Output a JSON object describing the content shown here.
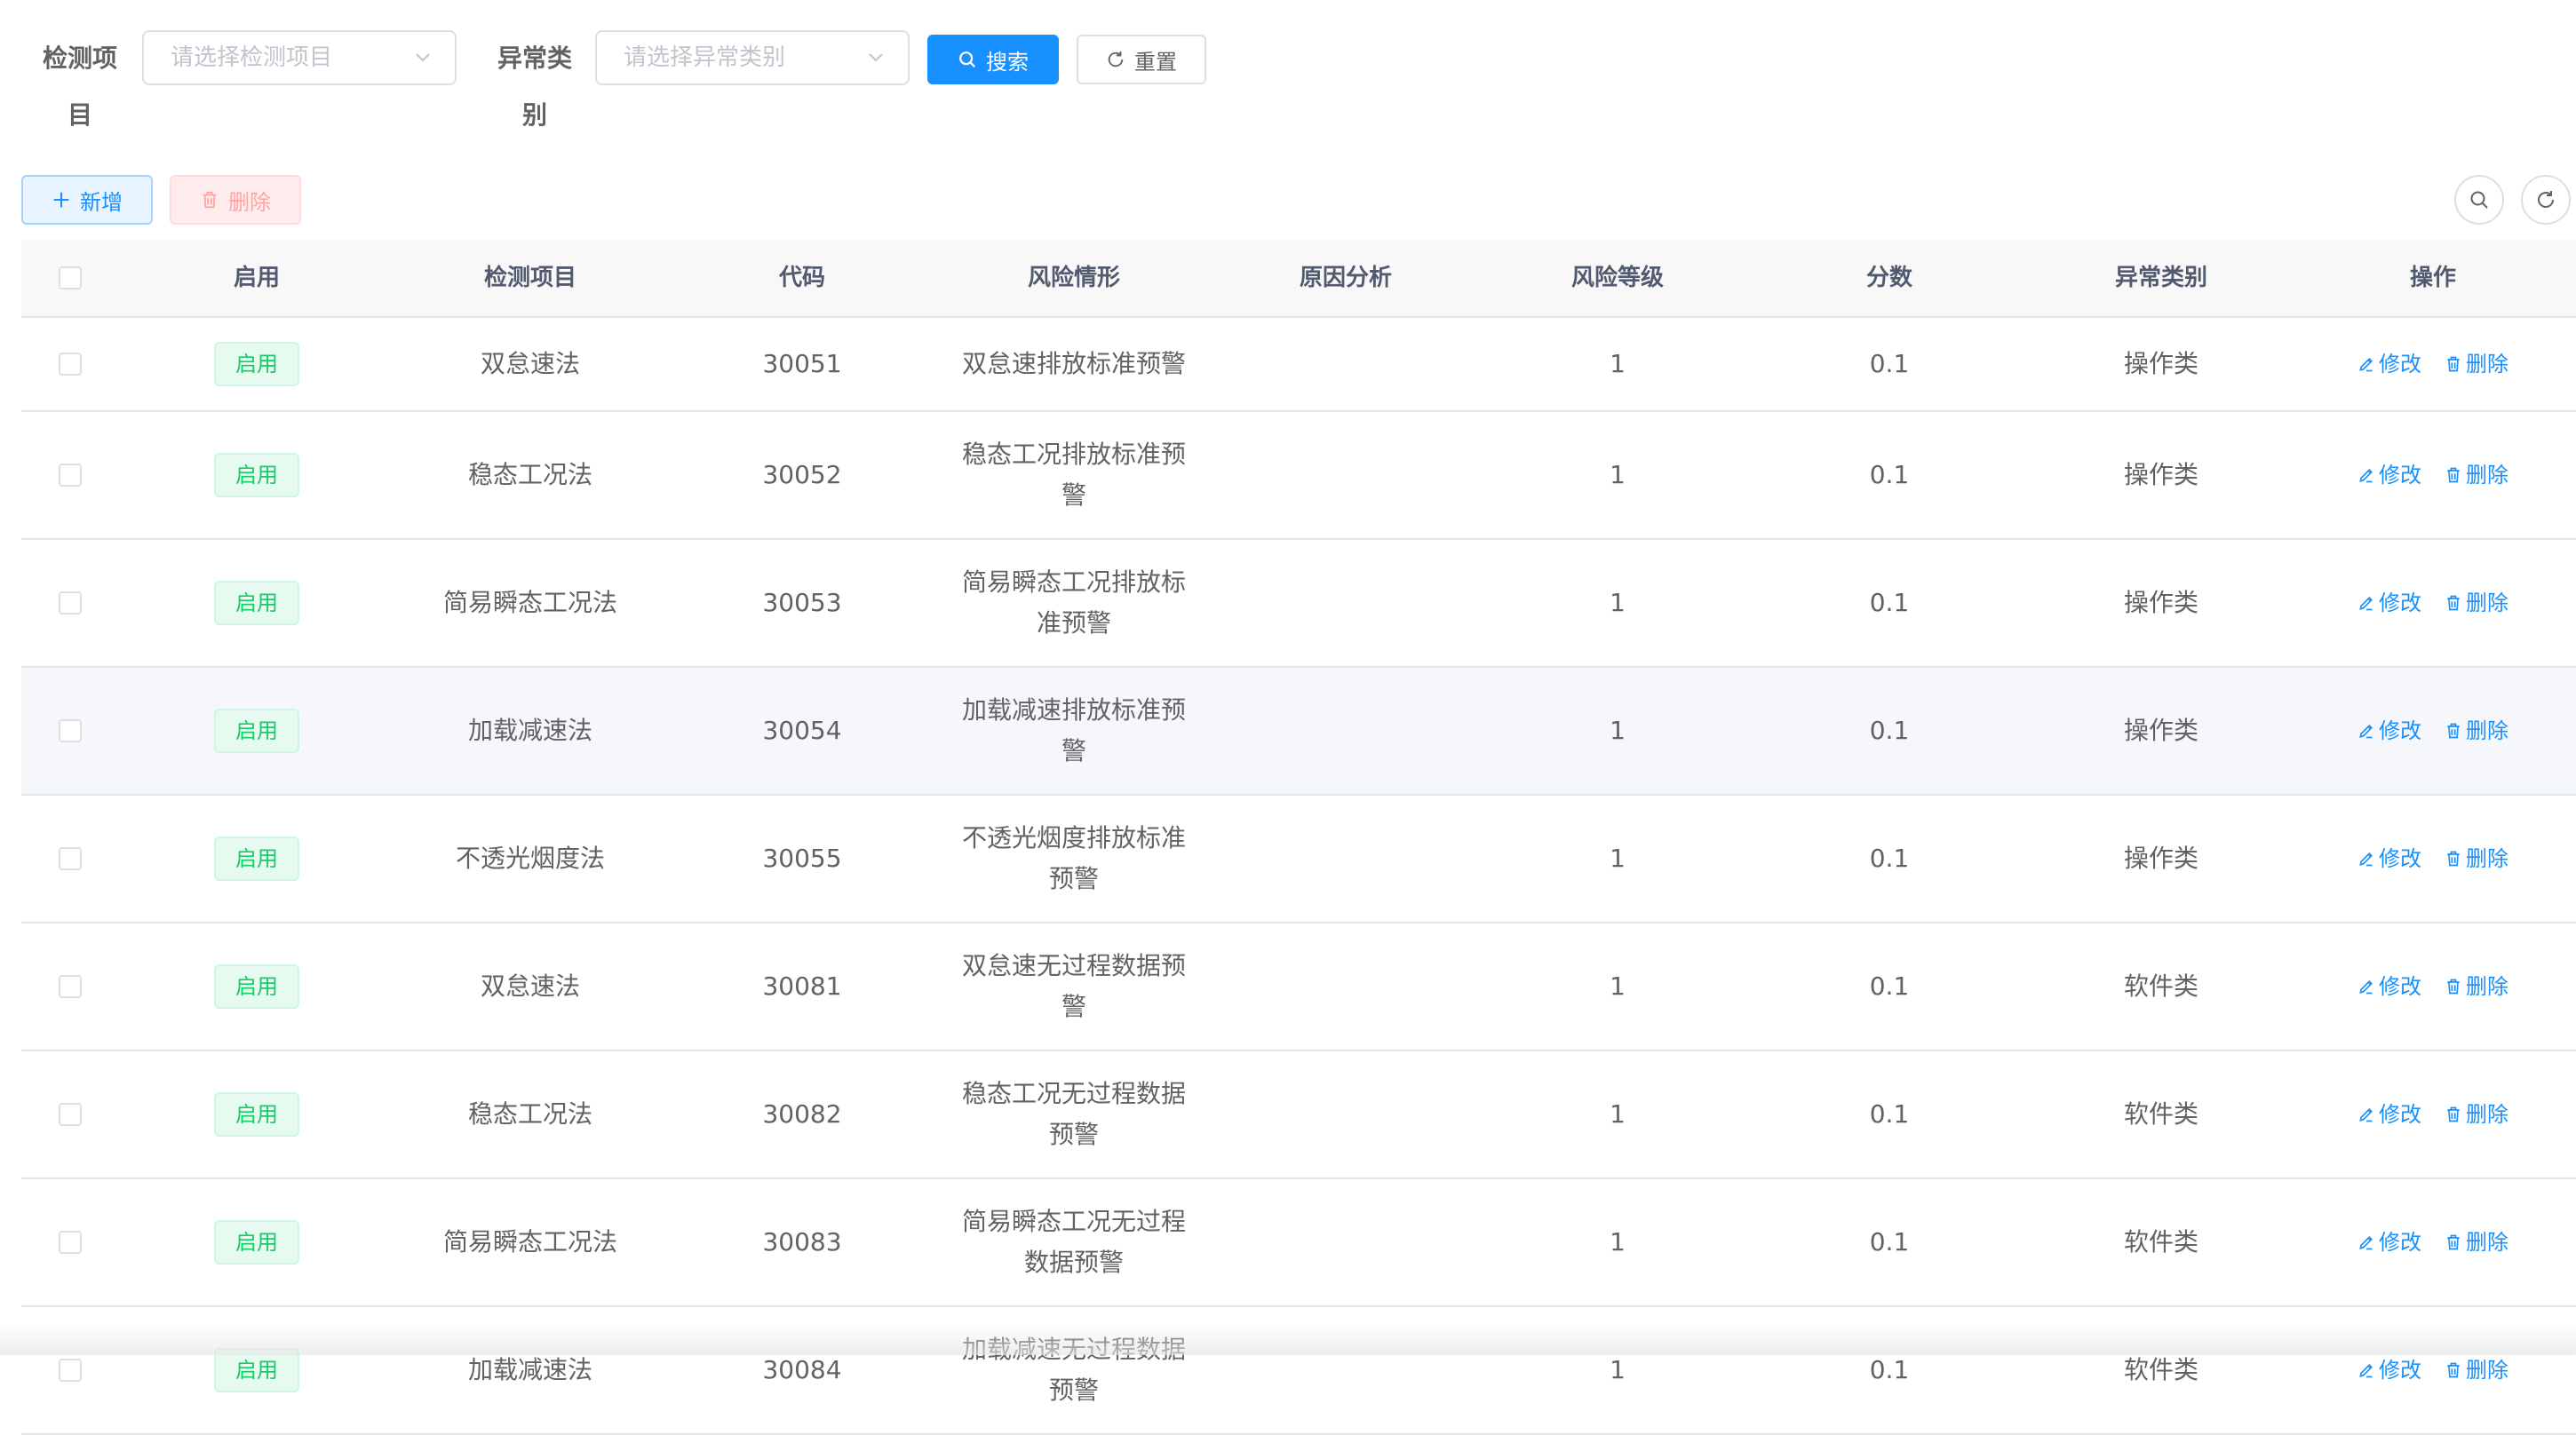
{
  "search_form": {
    "item_label_line1": "检测项",
    "item_label_line2": "目",
    "item_placeholder": "请选择检测项目",
    "type_label_line1": "异常类",
    "type_label_line2": "别",
    "type_placeholder": "请选择异常类别",
    "search_label": "搜索",
    "reset_label": "重置"
  },
  "toolbar": {
    "add_label": "新增",
    "delete_label": "删除"
  },
  "table": {
    "columns": [
      "启用",
      "检测项目",
      "代码",
      "风险情形",
      "原因分析",
      "风险等级",
      "分数",
      "异常类别",
      "操作"
    ],
    "edit_label": "修改",
    "delete_label": "删除",
    "rows": [
      {
        "status": "启用",
        "item": "双怠速法",
        "code": "30051",
        "risk_l1": "双怠速排放标准预警",
        "risk_l2": "",
        "reason": "",
        "level": "1",
        "score": "0.1",
        "type": "操作类"
      },
      {
        "status": "启用",
        "item": "稳态工况法",
        "code": "30052",
        "risk_l1": "稳态工况排放标准预",
        "risk_l2": "警",
        "reason": "",
        "level": "1",
        "score": "0.1",
        "type": "操作类"
      },
      {
        "status": "启用",
        "item": "简易瞬态工况法",
        "code": "30053",
        "risk_l1": "简易瞬态工况排放标",
        "risk_l2": "准预警",
        "reason": "",
        "level": "1",
        "score": "0.1",
        "type": "操作类"
      },
      {
        "status": "启用",
        "item": "加载减速法",
        "code": "30054",
        "risk_l1": "加载减速排放标准预",
        "risk_l2": "警",
        "reason": "",
        "level": "1",
        "score": "0.1",
        "type": "操作类"
      },
      {
        "status": "启用",
        "item": "不透光烟度法",
        "code": "30055",
        "risk_l1": "不透光烟度排放标准",
        "risk_l2": "预警",
        "reason": "",
        "level": "1",
        "score": "0.1",
        "type": "操作类"
      },
      {
        "status": "启用",
        "item": "双怠速法",
        "code": "30081",
        "risk_l1": "双怠速无过程数据预",
        "risk_l2": "警",
        "reason": "",
        "level": "1",
        "score": "0.1",
        "type": "软件类"
      },
      {
        "status": "启用",
        "item": "稳态工况法",
        "code": "30082",
        "risk_l1": "稳态工况无过程数据",
        "risk_l2": "预警",
        "reason": "",
        "level": "1",
        "score": "0.1",
        "type": "软件类"
      },
      {
        "status": "启用",
        "item": "简易瞬态工况法",
        "code": "30083",
        "risk_l1": "简易瞬态工况无过程",
        "risk_l2": "数据预警",
        "reason": "",
        "level": "1",
        "score": "0.1",
        "type": "软件类"
      },
      {
        "status": "启用",
        "item": "加载减速法",
        "code": "30084",
        "risk_l1": "加载减速无过程数据",
        "risk_l2": "预警",
        "reason": "",
        "level": "1",
        "score": "0.1",
        "type": "软件类"
      }
    ]
  },
  "colors": {
    "primary": "#1890ff",
    "success_tag": "#13ce66",
    "danger_plain": "#ffa3a3"
  },
  "icons": [
    "chevron-down-icon",
    "search-icon",
    "refresh-icon",
    "plus-icon",
    "trash-icon",
    "edit-icon"
  ]
}
